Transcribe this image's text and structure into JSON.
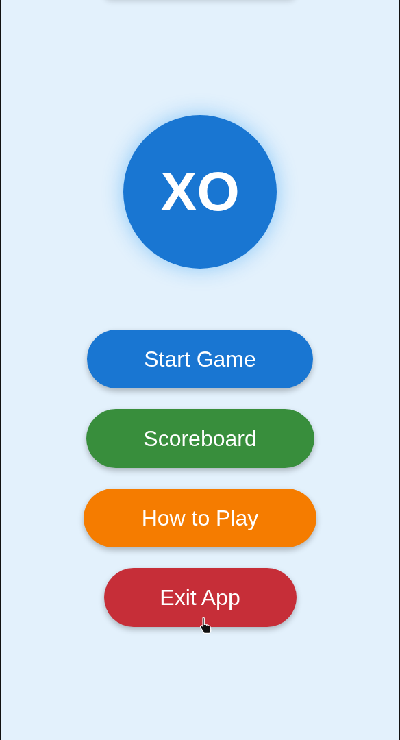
{
  "logo": {
    "text": "XO"
  },
  "menu_buttons": [
    {
      "label": "Start Game",
      "color": "#1976d2"
    },
    {
      "label": "Scoreboard",
      "color": "#388e3c"
    },
    {
      "label": "How to Play",
      "color": "#f57c00"
    },
    {
      "label": "Exit App",
      "color": "#c62e38"
    }
  ]
}
